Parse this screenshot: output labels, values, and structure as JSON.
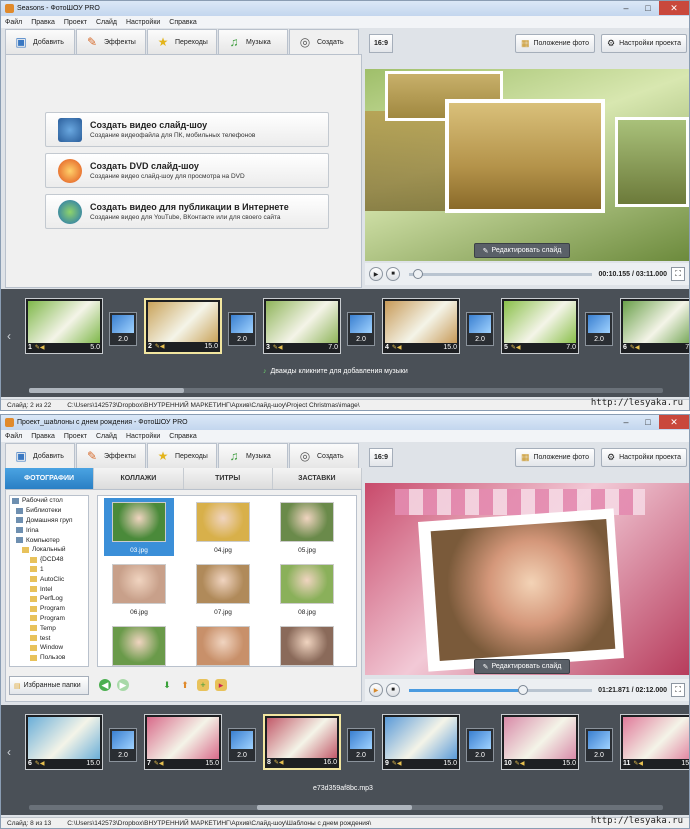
{
  "window1": {
    "title": "Seasons - ФотоШОУ PRO",
    "menu": [
      "Файл",
      "Правка",
      "Проект",
      "Слайд",
      "Настройки",
      "Справка"
    ],
    "tabs": [
      {
        "label": "Добавить",
        "icon": "folder-icon"
      },
      {
        "label": "Эффекты",
        "icon": "effects-icon"
      },
      {
        "label": "Переходы",
        "icon": "star-icon"
      },
      {
        "label": "Музыка",
        "icon": "music-icon"
      },
      {
        "label": "Создать",
        "icon": "film-icon"
      }
    ],
    "ratio": "16:9",
    "photo_position_label": "Положение фото",
    "project_settings_label": "Настройки проекта",
    "create_options": [
      {
        "title": "Создать видео слайд-шоу",
        "subtitle": "Создание видеофайла для ПК, мобильных телефонов"
      },
      {
        "title": "Создать DVD слайд-шоу",
        "subtitle": "Создание видео слайд-шоу для просмотра на DVD"
      },
      {
        "title": "Создать видео для публикации в Интернете",
        "subtitle": "Создание видео для YouTube, ВКонтакте или для своего сайта"
      }
    ],
    "edit_slide_label": "Редактировать слайд",
    "time": "00:10.155 / 03:11.000",
    "progress": 0.05,
    "slides": [
      {
        "num": "1",
        "dur": "5.0",
        "trans": "2.0"
      },
      {
        "num": "2",
        "dur": "15.0",
        "trans": "2.0"
      },
      {
        "num": "3",
        "dur": "7.0",
        "trans": "2.0"
      },
      {
        "num": "4",
        "dur": "15.0",
        "trans": "2.0"
      },
      {
        "num": "5",
        "dur": "7.0",
        "trans": "2.0"
      },
      {
        "num": "6",
        "dur": "7.0",
        "trans": ""
      }
    ],
    "music_hint": "Дважды кликните для добавления музыки",
    "status_slide": "Слайд: 2 из 22",
    "status_path": "C:\\Users\\142573\\Dropbox\\ВНУТРЕННИЙ МАРКЕТИНГ\\Архив\\Слайд-шоу\\Project Christmas\\image\\",
    "watermark": "http://lesyaka.ru"
  },
  "window2": {
    "title": "Проект_шаблоны с днем рождения - ФотоШОУ PRO",
    "menu": [
      "Файл",
      "Правка",
      "Проект",
      "Слайд",
      "Настройки",
      "Справка"
    ],
    "tabs": [
      {
        "label": "Добавить",
        "icon": "folder-icon"
      },
      {
        "label": "Эффекты",
        "icon": "effects-icon"
      },
      {
        "label": "Переходы",
        "icon": "star-icon"
      },
      {
        "label": "Музыка",
        "icon": "music-icon"
      },
      {
        "label": "Создать",
        "icon": "film-icon"
      }
    ],
    "subtabs": [
      "ФОТОГРАФИИ",
      "КОЛЛАЖИ",
      "ТИТРЫ",
      "ЗАСТАВКИ"
    ],
    "tree": [
      "Рабочий стол",
      "Библиотеки",
      "Домашняя груп",
      "Irina",
      "Компьютер",
      "Локальный",
      "{DCD48",
      "1",
      "AutoClic",
      "Intel",
      "PerfLog",
      "Program",
      "Program",
      "Temp",
      "test",
      "Window",
      "Пользов"
    ],
    "files": [
      "03.jpg",
      "04.jpg",
      "05.jpg",
      "06.jpg",
      "07.jpg",
      "08.jpg",
      "",
      "",
      ""
    ],
    "fav_label": "Избранные папки",
    "ratio": "16:9",
    "photo_position_label": "Положение фото",
    "project_settings_label": "Настройки проекта",
    "edit_slide_label": "Редактировать слайд",
    "time": "01:21.871 / 02:12.000",
    "progress": 0.62,
    "slides": [
      {
        "num": "6",
        "dur": "15.0",
        "trans": "2.0"
      },
      {
        "num": "7",
        "dur": "15.0",
        "trans": "2.0"
      },
      {
        "num": "8",
        "dur": "16.0",
        "trans": "2.0"
      },
      {
        "num": "9",
        "dur": "15.0",
        "trans": "2.0"
      },
      {
        "num": "10",
        "dur": "15.0",
        "trans": "2.0"
      },
      {
        "num": "11",
        "dur": "15.0",
        "trans": ""
      }
    ],
    "music_file": "e73d359af8bc.mp3",
    "status_slide": "Слайд: 8 из 13",
    "status_path": "C:\\Users\\142573\\Dropbox\\ВНУТРЕННИЙ МАРКЕТИНГ\\Архив\\Слайд-шоу\\Шаблоны с днем рождения\\",
    "watermark": "http://lesyaka.ru"
  }
}
